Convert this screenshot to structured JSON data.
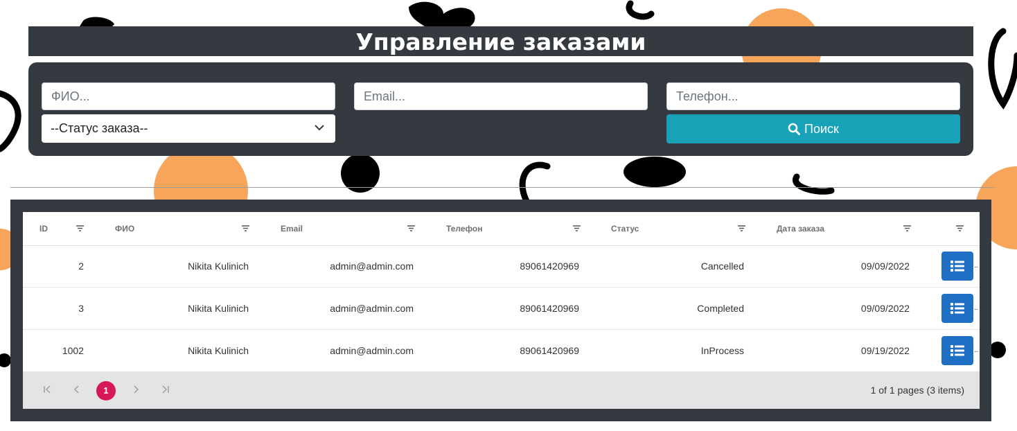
{
  "page": {
    "title": "Управление заказами"
  },
  "filters": {
    "fio_placeholder": "ФИО...",
    "email_placeholder": "Email...",
    "phone_placeholder": "Телефон...",
    "status_selected": "--Статус заказа--",
    "search_label": "Поиск"
  },
  "grid": {
    "columns": [
      "ID",
      "ФИО",
      "Email",
      "Телефон",
      "Статус",
      "Дата заказа"
    ],
    "rows": [
      {
        "id": "2",
        "fio": "Nikita Kulinich",
        "email": "admin@admin.com",
        "phone": "89061420969",
        "status": "Cancelled",
        "date": "09/09/2022"
      },
      {
        "id": "3",
        "fio": "Nikita Kulinich",
        "email": "admin@admin.com",
        "phone": "89061420969",
        "status": "Completed",
        "date": "09/09/2022"
      },
      {
        "id": "1002",
        "fio": "Nikita Kulinich",
        "email": "admin@admin.com",
        "phone": "89061420969",
        "status": "InProcess",
        "date": "09/19/2022"
      }
    ]
  },
  "pager": {
    "current_page": "1",
    "info": "1 of 1 pages (3 items)"
  },
  "colors": {
    "panel": "#353940",
    "search_button": "#17a2b8",
    "detail_button": "#1f6fc5",
    "current_page": "#d6185a",
    "doodle_orange": "#f6a55a"
  },
  "icons": [
    "search-icon",
    "chevron-down-icon",
    "filter-icon",
    "list-icon",
    "first-page-icon",
    "prev-page-icon",
    "next-page-icon",
    "last-page-icon"
  ]
}
